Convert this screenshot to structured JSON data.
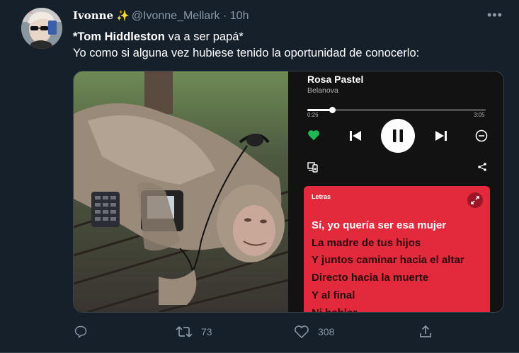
{
  "tweet": {
    "display_name": "Ivonne",
    "badge_icon": "sparkle-icon",
    "handle": "@Ivonne_Mellark",
    "separator": "·",
    "time": "10h",
    "more_icon": "more-icon",
    "text_bold": "*Tom Hiddleston",
    "text_rest": " va a ser papá*",
    "text_line2": "Yo como si alguna vez hubiese tenido la oportunidad de conocerlo:"
  },
  "player": {
    "song_title": "Rosa Pastel",
    "artist": "Belanova",
    "elapsed": "0:26",
    "total": "3:05",
    "progress_fraction": 0.14,
    "lyrics_label": "Letras",
    "lyrics": [
      "Sí, yo quería ser esa mujer",
      "La madre de tus hijos",
      "Y juntos caminar hacia el altar",
      "Directo hacia la muerte",
      "Y al final",
      "Ni hablar"
    ],
    "accent_color": "#1db954",
    "lyrics_bg_color": "#e22a3c"
  },
  "actions": {
    "reply_count": "",
    "retweet_count": "73",
    "like_count": "308"
  },
  "colors": {
    "background": "#15202b",
    "secondary_text": "#8b98a5"
  }
}
